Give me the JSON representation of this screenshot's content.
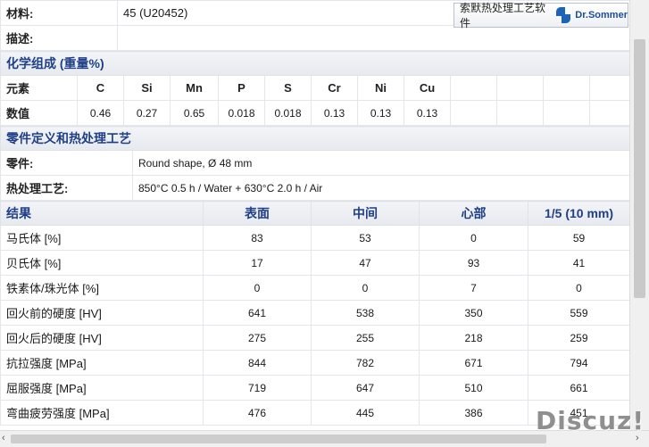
{
  "header": {
    "material_label": "材料:",
    "material_value": "45 (U20452)",
    "description_label": "描述:",
    "logo_button": {
      "text": "索默热处理工艺软件",
      "brand": "Dr.Sommer"
    }
  },
  "composition": {
    "section_title": "化学组成  (重量%)",
    "element_row_label": "元素",
    "value_row_label": "数值",
    "elements": [
      "C",
      "Si",
      "Mn",
      "P",
      "S",
      "Cr",
      "Ni",
      "Cu"
    ],
    "values": [
      "0.46",
      "0.27",
      "0.65",
      "0.018",
      "0.018",
      "0.13",
      "0.13",
      "0.13"
    ]
  },
  "part": {
    "section_title": "零件定义和热处理工艺",
    "part_label": "零件:",
    "part_value": "Round shape, Ø 48 mm",
    "process_label": "热处理工艺:",
    "process_value": "850°C 0.5 h / Water + 630°C 2.0 h / Air"
  },
  "results": {
    "headers": [
      "结果",
      "表面",
      "中间",
      "心部",
      "1/5 (10 mm)"
    ],
    "rows": [
      {
        "label": "马氏体 [%]",
        "values": [
          "83",
          "53",
          "0",
          "59"
        ]
      },
      {
        "label": "贝氏体 [%]",
        "values": [
          "17",
          "47",
          "93",
          "41"
        ]
      },
      {
        "label": "铁素体/珠光体 [%]",
        "values": [
          "0",
          "0",
          "7",
          "0"
        ]
      },
      {
        "label": "回火前的硬度 [HV]",
        "values": [
          "641",
          "538",
          "350",
          "559"
        ]
      },
      {
        "label": "回火后的硬度 [HV]",
        "values": [
          "275",
          "255",
          "218",
          "259"
        ]
      },
      {
        "label": "抗拉强度 [MPa]",
        "values": [
          "844",
          "782",
          "671",
          "794"
        ]
      },
      {
        "label": "屈服强度 [MPa]",
        "values": [
          "719",
          "647",
          "510",
          "661"
        ]
      },
      {
        "label": "弯曲疲劳强度 [MPa]",
        "values": [
          "476",
          "445",
          "386",
          "451"
        ]
      }
    ]
  },
  "watermark": "Discuz!",
  "scrollbar": {
    "left_arrow": "‹",
    "right_arrow": "›"
  }
}
